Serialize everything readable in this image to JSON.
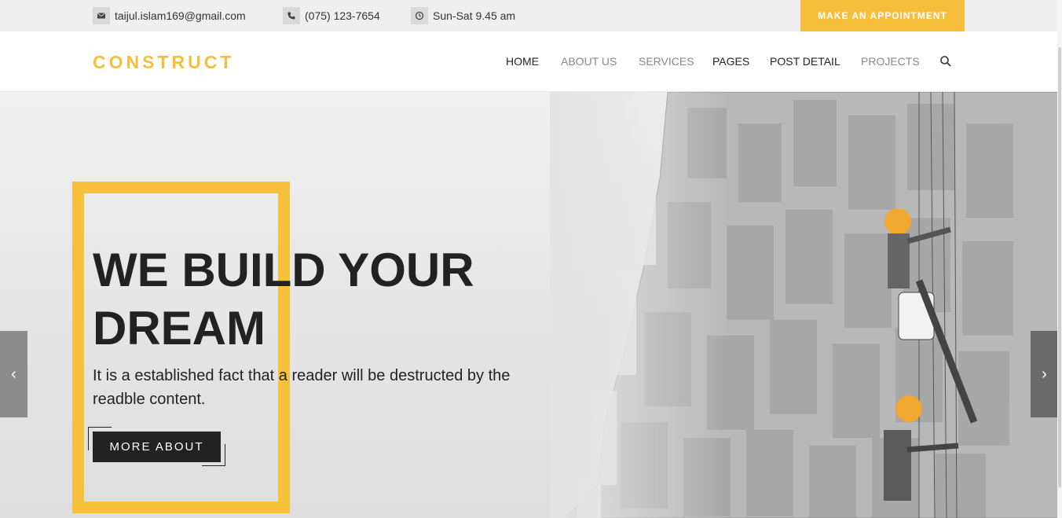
{
  "topbar": {
    "email": "taijul.islam169@gmail.com",
    "phone": "(075) 123-7654",
    "hours": "Sun-Sat 9.45 am",
    "appointment_label": "MAKE AN APPOINTMENT",
    "icons": {
      "email": "mail-icon",
      "phone": "phone-icon",
      "hours": "clock-icon"
    }
  },
  "navbar": {
    "logo": "CONSTRUCT",
    "items": [
      {
        "label": "HOME"
      },
      {
        "label": "ABOUT US"
      },
      {
        "label": "SERVICES"
      },
      {
        "label": "PAGES"
      },
      {
        "label": "POST DETAIL"
      },
      {
        "label": "PROJECTS"
      }
    ],
    "search_icon": "search-icon"
  },
  "hero": {
    "headline": "WE BUILD YOUR DREAM",
    "subtext": "It is a established fact that a reader will be destructed by the readble content.",
    "button_label": "MORE ABOUT",
    "prev_arrow": "‹",
    "next_arrow": "›"
  },
  "colors": {
    "accent": "#f5bf3c",
    "dark": "#222222",
    "topbar_bg": "#efefef"
  }
}
